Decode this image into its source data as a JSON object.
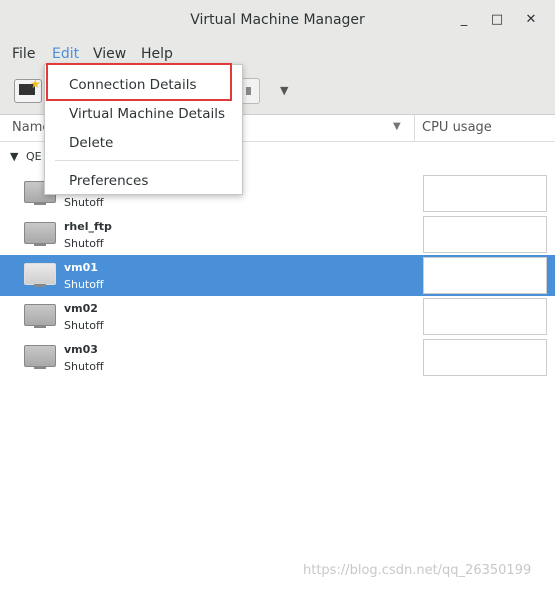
{
  "window": {
    "title": "Virtual Machine Manager",
    "minimize": "_",
    "maximize": "□",
    "close": "✕"
  },
  "menubar": {
    "file": "File",
    "edit": "Edit",
    "view": "View",
    "help": "Help"
  },
  "columns": {
    "name": "Name",
    "cpu": "CPU usage"
  },
  "group": {
    "label": "QE"
  },
  "vms": [
    {
      "name": "",
      "status": "Shutoff"
    },
    {
      "name": "rhel_ftp",
      "status": "Shutoff"
    },
    {
      "name": "vm01",
      "status": "Shutoff"
    },
    {
      "name": "vm02",
      "status": "Shutoff"
    },
    {
      "name": "vm03",
      "status": "Shutoff"
    }
  ],
  "edit_menu": {
    "items": [
      "Connection Details",
      "Virtual Machine Details",
      "Delete",
      "Preferences"
    ]
  },
  "watermark": "https://blog.csdn.net/qq_26350199",
  "colors": {
    "selection": "#4a90d9",
    "highlight_box": "#e03a3a"
  }
}
